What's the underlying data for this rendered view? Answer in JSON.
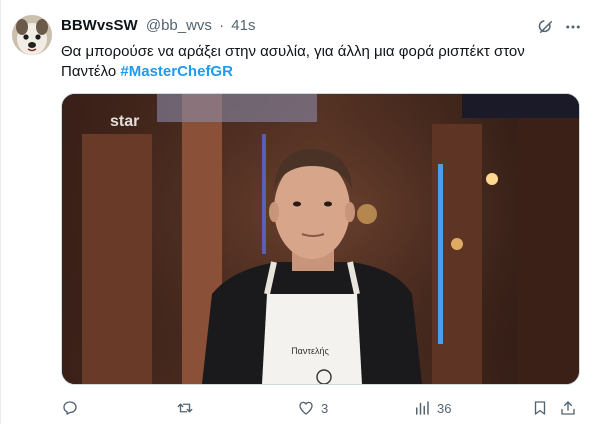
{
  "tweet": {
    "display_name": "BBWvsSW",
    "handle": "@bb_wvs",
    "separator": "·",
    "time": "41s",
    "text_line1": "Θα  μπορούσε να αράξει στην ασυλία, για άλλη μια φορά ρισπέκτ στον",
    "text_line2": "Παντέλο",
    "hashtag": "#MasterChefGR"
  },
  "media": {
    "watermark": "star",
    "apron_name": "Παντελής"
  },
  "actions": {
    "reply_count": "",
    "retweet_count": "",
    "like_count": "3",
    "views_count": "36"
  },
  "icons": {
    "grok": "grok-icon",
    "more": "more-dots-icon",
    "reply": "reply-icon",
    "retweet": "retweet-icon",
    "like": "heart-icon",
    "views": "views-icon",
    "bookmark": "bookmark-icon",
    "share": "share-icon"
  },
  "colors": {
    "accent": "#1d9bf0",
    "text": "#0f1419",
    "secondary": "#536471"
  }
}
